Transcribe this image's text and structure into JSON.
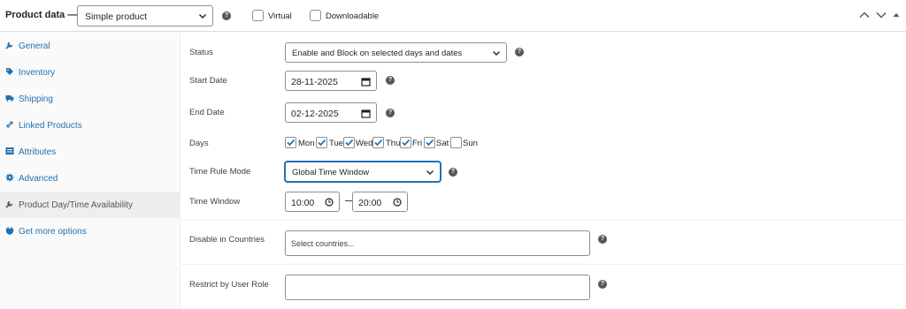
{
  "header": {
    "title": "Product data —",
    "product_type": "Simple product",
    "virtual_label": "Virtual",
    "downloadable_label": "Downloadable"
  },
  "sidebar": {
    "items": [
      {
        "label": "General",
        "icon": "wrench-icon"
      },
      {
        "label": "Inventory",
        "icon": "tag-icon"
      },
      {
        "label": "Shipping",
        "icon": "truck-icon"
      },
      {
        "label": "Linked Products",
        "icon": "link-icon"
      },
      {
        "label": "Attributes",
        "icon": "list-icon"
      },
      {
        "label": "Advanced",
        "icon": "gear-icon"
      },
      {
        "label": "Product Day/Time Availability",
        "icon": "wrench-icon"
      },
      {
        "label": "Get more options",
        "icon": "plugin-icon"
      }
    ],
    "active_index": 6
  },
  "form": {
    "status_label": "Status",
    "status_value": "Enable and Block on selected days and dates",
    "start_date_label": "Start Date",
    "start_date_value": "28-11-2025",
    "end_date_label": "End Date",
    "end_date_value": "02-12-2025",
    "days_label": "Days",
    "days": [
      {
        "label": "Mon",
        "checked": true
      },
      {
        "label": "Tue",
        "checked": true
      },
      {
        "label": "Wed",
        "checked": true
      },
      {
        "label": "Thu",
        "checked": true
      },
      {
        "label": "Fri",
        "checked": true
      },
      {
        "label": "Sat",
        "checked": true
      },
      {
        "label": "Sun",
        "checked": false
      }
    ],
    "time_rule_label": "Time Rule Mode",
    "time_rule_value": "Global Time Window",
    "time_window_label": "Time Window",
    "time_start": "10:00",
    "time_end": "20:00",
    "countries_label": "Disable in Countries",
    "countries_placeholder": "Select countries...",
    "role_label": "Restrict by User Role",
    "role_value": ""
  },
  "colors": {
    "link": "#2271b1",
    "focus": "#2271b1",
    "text": "#1d2327"
  }
}
